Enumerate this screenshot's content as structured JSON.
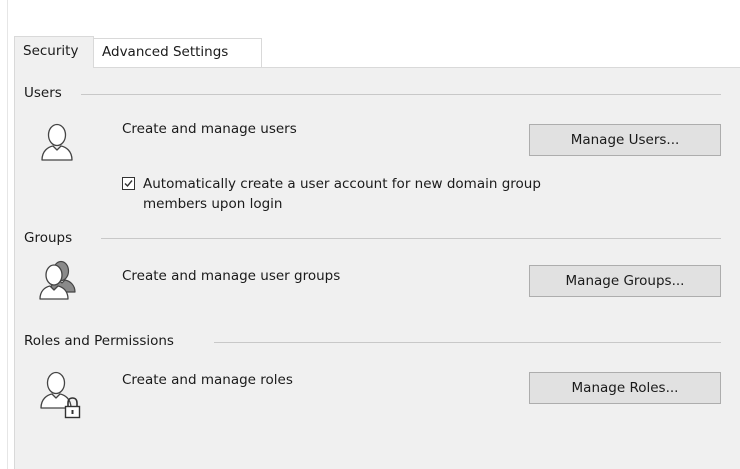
{
  "tabs": [
    {
      "label": "Security",
      "active": true
    },
    {
      "label": "Advanced Settings",
      "active": false
    }
  ],
  "users": {
    "header": "Users",
    "icon": "user-icon",
    "description": "Create and manage users",
    "button_label": "Manage Users...",
    "auto_create_checkbox": {
      "checked": true,
      "label": "Automatically create a user account for new domain group members upon login"
    }
  },
  "groups": {
    "header": "Groups",
    "icon": "user-group-icon",
    "description": "Create and manage user groups",
    "button_label": "Manage Groups..."
  },
  "roles": {
    "header": "Roles and Permissions",
    "icon": "user-lock-icon",
    "description": "Create and manage roles",
    "button_label": "Manage Roles..."
  },
  "colors": {
    "panel_bg": "#f0f0f0",
    "button_bg": "#e1e1e1",
    "button_border": "#adadad",
    "separator": "#c8c8c8"
  }
}
